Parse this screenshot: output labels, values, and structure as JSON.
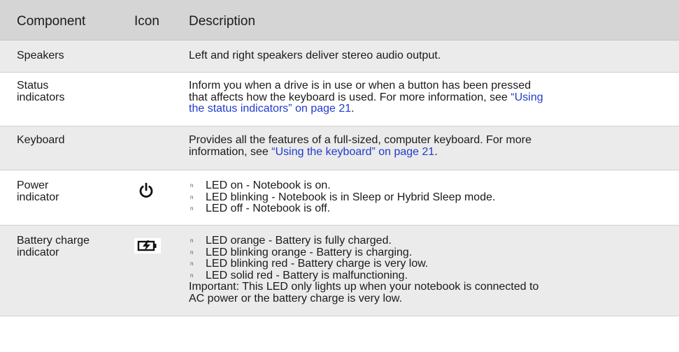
{
  "header": {
    "component": "Component",
    "icon": "Icon",
    "description": "Description"
  },
  "rows": [
    {
      "component": "Speakers",
      "description": "Left and right speakers deliver stereo audio output."
    },
    {
      "component_line1": "Status",
      "component_line2": "indicators",
      "desc_line1": "Inform you when a drive is in use or when a button has been pressed",
      "desc_line2_pre": "that affects how the keyboard is used. For more information, see ",
      "desc_line2_link": "“Using",
      "desc_line3_link": "the status indicators” on page 21",
      "desc_line3_post": "."
    },
    {
      "component": "Keyboard",
      "desc_line1": "Provides all the features of a full-sized, computer keyboard. For more",
      "desc_line2_pre": "information, see ",
      "desc_line2_link": "“Using the keyboard” on page 21",
      "desc_line2_post": "."
    },
    {
      "component_line1": "Power",
      "component_line2": "indicator",
      "icon": "power-icon",
      "bullets": [
        "LED on - Notebook is on.",
        "LED blinking - Notebook is in Sleep or Hybrid Sleep mode.",
        "LED off - Notebook is off."
      ]
    },
    {
      "component_line1": "Battery charge",
      "component_line2": "indicator",
      "icon": "battery-charging-icon",
      "bullets": [
        "LED orange - Battery is fully charged.",
        "LED blinking orange - Battery is charging.",
        "LED blinking red - Battery charge is very low.",
        "LED solid red - Battery is malfunctioning."
      ],
      "note_line1": "Important: This LED only lights up when your notebook is connected to",
      "note_line2": "AC power or the battery charge is very low."
    }
  ],
  "bullet_marker": "n",
  "colors": {
    "header_bg": "#d5d5d5",
    "row_shaded": "#ebebeb",
    "link": "#1f3ccc"
  }
}
